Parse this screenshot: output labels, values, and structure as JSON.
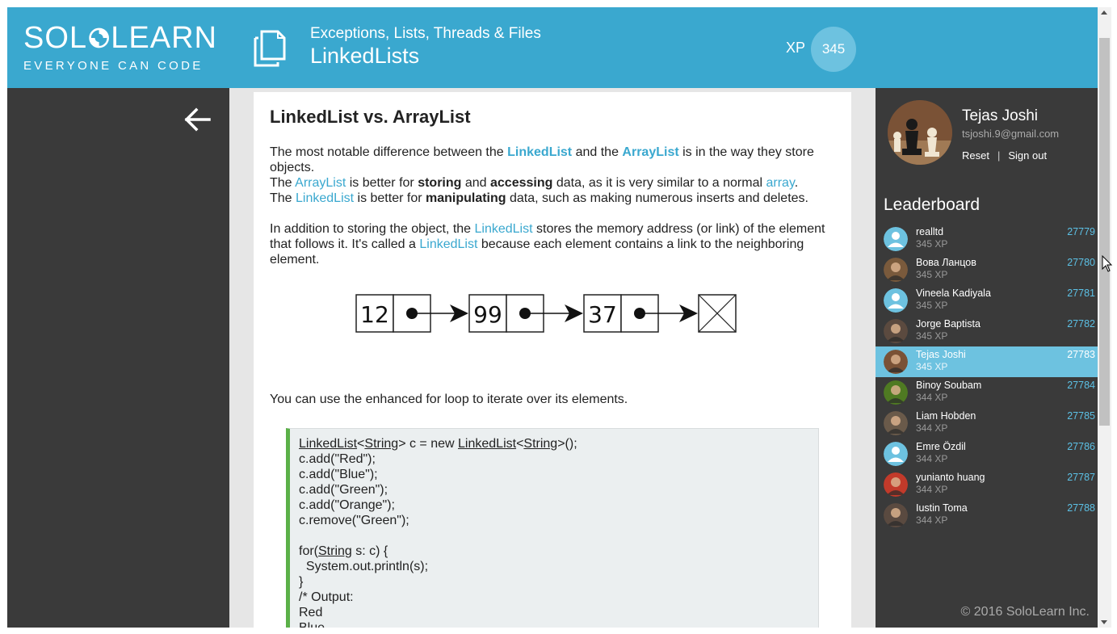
{
  "brand": {
    "name_left": "SOL",
    "name_right": "LEARN",
    "tagline": "EVERYONE CAN CODE"
  },
  "header": {
    "course_subtitle": "Exceptions, Lists, Threads & Files",
    "lesson_title": "LinkedLists",
    "xp_label": "XP",
    "xp_value": "345"
  },
  "lesson": {
    "heading": "LinkedList vs. ArrayList",
    "p1": {
      "t1": "The most notable difference between the ",
      "k1": "LinkedList",
      "t2": " and the ",
      "k2": "ArrayList",
      "t3": " is in the way they store objects."
    },
    "p2": {
      "t1": "The ",
      "k1": "ArrayList",
      "t2": " is better for ",
      "b1": "storing",
      "t3": " and ",
      "b2": "accessing",
      "t4": " data, as it is very similar to a normal ",
      "k2": "array",
      "t5": "."
    },
    "p3": {
      "t1": "The ",
      "k1": "LinkedList",
      "t2": " is better for ",
      "b1": "manipulating",
      "t3": " data, such as making numerous inserts and deletes."
    },
    "p4": {
      "t1": "In addition to storing the object, the ",
      "k1": "LinkedList",
      "t2": " stores the memory address (or link) of the element that follows it. It's called a ",
      "k2": "LinkedList",
      "t3": " because each element contains a link to the neighboring element."
    },
    "diagram_nodes": [
      "12",
      "99",
      "37"
    ],
    "p5": "You can use the enhanced for loop to iterate over its elements.",
    "code_lines": [
      "c.add(\"Red\");",
      "c.add(\"Blue\");",
      "c.add(\"Green\");",
      "c.add(\"Orange\");",
      "c.remove(\"Green\");",
      "",
      "for(String s: c) {",
      "  System.out.println(s);",
      "}",
      "/* Output:",
      "Red",
      "Blue"
    ],
    "code_line1": {
      "a": "LinkedList",
      "b": "<",
      "c": "String",
      "d": "> c = new ",
      "e": "LinkedList",
      "f": "<",
      "g": "String",
      "h": ">();"
    }
  },
  "profile": {
    "name": "Tejas Joshi",
    "email": "tsjoshi.9@gmail.com",
    "reset_label": "Reset",
    "separator": "|",
    "signout_label": "Sign out"
  },
  "leaderboard": {
    "title": "Leaderboard",
    "rows": [
      {
        "name": "realltd",
        "xp": "345 XP",
        "rank": "27779",
        "avatar": "default-user-icon"
      },
      {
        "name": "Вова Ланцов",
        "xp": "345 XP",
        "rank": "27780",
        "avatar": "photo"
      },
      {
        "name": "Vineela Kadiyala",
        "xp": "345 XP",
        "rank": "27781",
        "avatar": "default-user-icon"
      },
      {
        "name": "Jorge Baptista",
        "xp": "345 XP",
        "rank": "27782",
        "avatar": "photo"
      },
      {
        "name": "Tejas Joshi",
        "xp": "345 XP",
        "rank": "27783",
        "avatar": "photo",
        "active": true
      },
      {
        "name": "Binoy Soubam",
        "xp": "344 XP",
        "rank": "27784",
        "avatar": "photo"
      },
      {
        "name": "Liam Hobden",
        "xp": "344 XP",
        "rank": "27785",
        "avatar": "photo"
      },
      {
        "name": "Emre Özdil",
        "xp": "344 XP",
        "rank": "27786",
        "avatar": "default-user-icon"
      },
      {
        "name": "yunianto huang",
        "xp": "344 XP",
        "rank": "27787",
        "avatar": "photo"
      },
      {
        "name": "Iustin Toma",
        "xp": "344 XP",
        "rank": "27788",
        "avatar": "photo"
      }
    ]
  },
  "footer": {
    "copyright": "© 2016 SoloLearn Inc."
  },
  "colors": {
    "brand_blue": "#3aa8cf",
    "highlight": "#6dc2e0",
    "dark_panel": "#3a3a3a",
    "code_accent": "#5bb048",
    "rank_blue": "#5cc1e6"
  }
}
